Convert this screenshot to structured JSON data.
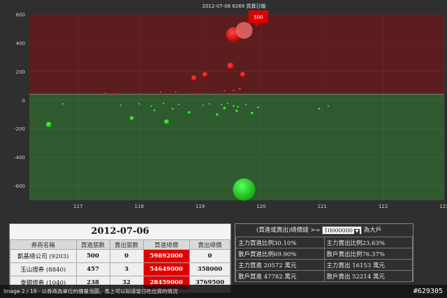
{
  "chart_data": {
    "type": "scatter",
    "title": "2012-07-06  6269 買賣日報",
    "xlabel": "",
    "ylabel": "",
    "xlim": [
      116.2,
      123
    ],
    "ylim": [
      -700,
      600
    ],
    "x_ticks": [
      "117",
      "118",
      "119",
      "120",
      "121",
      "122",
      "123"
    ],
    "y_ticks": [
      "600",
      "400",
      "200",
      "0",
      "-200",
      "-400",
      "-600"
    ],
    "tooltip_value": "500",
    "zones": [
      {
        "name": "buy",
        "range": [
          0,
          600
        ],
        "color": "#5a1c1c"
      },
      {
        "name": "sell",
        "range": [
          -700,
          0
        ],
        "color": "#2f5b2f"
      }
    ],
    "series": [
      {
        "color": "#d51414",
        "points": [
          {
            "x": 119.55,
            "y": 460,
            "s": 11
          },
          {
            "x": 119.72,
            "y": 490,
            "s": 12
          },
          {
            "x": 119.5,
            "y": 240,
            "s": 5
          },
          {
            "x": 119.08,
            "y": 180,
            "s": 4
          },
          {
            "x": 119.7,
            "y": 180,
            "s": 4
          },
          {
            "x": 118.9,
            "y": 155,
            "s": 4
          },
          {
            "x": 117.45,
            "y": 50,
            "s": 1.5
          },
          {
            "x": 117.6,
            "y": 45,
            "s": 1.5
          },
          {
            "x": 118.35,
            "y": 55,
            "s": 1.5
          },
          {
            "x": 118.6,
            "y": 60,
            "s": 1.5
          },
          {
            "x": 119.4,
            "y": 65,
            "s": 1.5
          },
          {
            "x": 119.55,
            "y": 70,
            "s": 1.5
          },
          {
            "x": 119.65,
            "y": 80,
            "s": 2
          },
          {
            "x": 118.95,
            "y": 40,
            "s": 1.5
          }
        ]
      },
      {
        "color": "#16d116",
        "points": [
          {
            "x": 119.72,
            "y": -625,
            "s": 16
          },
          {
            "x": 116.52,
            "y": -170,
            "s": 4
          },
          {
            "x": 117.88,
            "y": -125,
            "s": 3
          },
          {
            "x": 118.45,
            "y": -150,
            "s": 3.5
          },
          {
            "x": 118.82,
            "y": -85,
            "s": 2
          },
          {
            "x": 119.28,
            "y": -100,
            "s": 2
          },
          {
            "x": 119.4,
            "y": -55,
            "s": 2
          },
          {
            "x": 119.6,
            "y": -75,
            "s": 2
          },
          {
            "x": 119.85,
            "y": -90,
            "s": 2
          },
          {
            "x": 118.25,
            "y": -70,
            "s": 1.5
          },
          {
            "x": 118.55,
            "y": -60,
            "s": 1.5
          },
          {
            "x": 119.55,
            "y": -40,
            "s": 1.5
          },
          {
            "x": 119.05,
            "y": -35,
            "s": 1.2
          },
          {
            "x": 119.15,
            "y": -25,
            "s": 1.2
          },
          {
            "x": 119.35,
            "y": -30,
            "s": 1.2
          },
          {
            "x": 119.45,
            "y": -20,
            "s": 1.2
          },
          {
            "x": 119.62,
            "y": -45,
            "s": 1.5
          },
          {
            "x": 119.75,
            "y": -30,
            "s": 1.2
          },
          {
            "x": 118.0,
            "y": -25,
            "s": 1.2
          },
          {
            "x": 118.2,
            "y": -40,
            "s": 1.2
          },
          {
            "x": 118.4,
            "y": -20,
            "s": 1.2
          },
          {
            "x": 118.65,
            "y": -30,
            "s": 1.2
          },
          {
            "x": 117.7,
            "y": -35,
            "s": 1.2
          },
          {
            "x": 120.95,
            "y": -60,
            "s": 1.5
          },
          {
            "x": 121.1,
            "y": -40,
            "s": 1.2
          },
          {
            "x": 116.75,
            "y": -25,
            "s": 1.2
          },
          {
            "x": 119.95,
            "y": -50,
            "s": 1.5
          }
        ]
      }
    ]
  },
  "broker_table": {
    "date": "2012-07-06",
    "headers": [
      "券商名稱",
      "買進張數",
      "賣出張數",
      "買進總價",
      "賣出總價"
    ],
    "rows": [
      {
        "name": "凱基總公司 (9203)",
        "buy_qty": "500",
        "sell_qty": "0",
        "buy_total": "59892000",
        "sell_total": "0"
      },
      {
        "name": "玉山證券 (8840)",
        "buy_qty": "457",
        "sell_qty": "3",
        "buy_total": "54649000",
        "sell_total": "358000"
      },
      {
        "name": "臺銀證券 (1040)",
        "buy_qty": "238",
        "sell_qty": "32",
        "buy_total": "28459000",
        "sell_total": "3769500"
      }
    ]
  },
  "summary": {
    "head_prefix": "(買進或賣出)總價錢 >=",
    "threshold": "10000000",
    "head_suffix": "為大戶",
    "rows": [
      [
        "主力買進比例30.10%",
        "主力賣出比例23.63%"
      ],
      [
        "散戶買進比例69.90%",
        "散戶賣出比例76.37%"
      ],
      [
        "主力買進 20572 萬元",
        "主力賣出 16153 萬元"
      ],
      [
        "散戶買進 47782 萬元",
        "散戶賣出 52214 萬元"
      ]
    ]
  },
  "status": {
    "caption": "Image 2 / 18 · 以券商為單位的價量泡圖，馬上可以知道當日吃出貨的情況",
    "photo_id": "#629305"
  }
}
